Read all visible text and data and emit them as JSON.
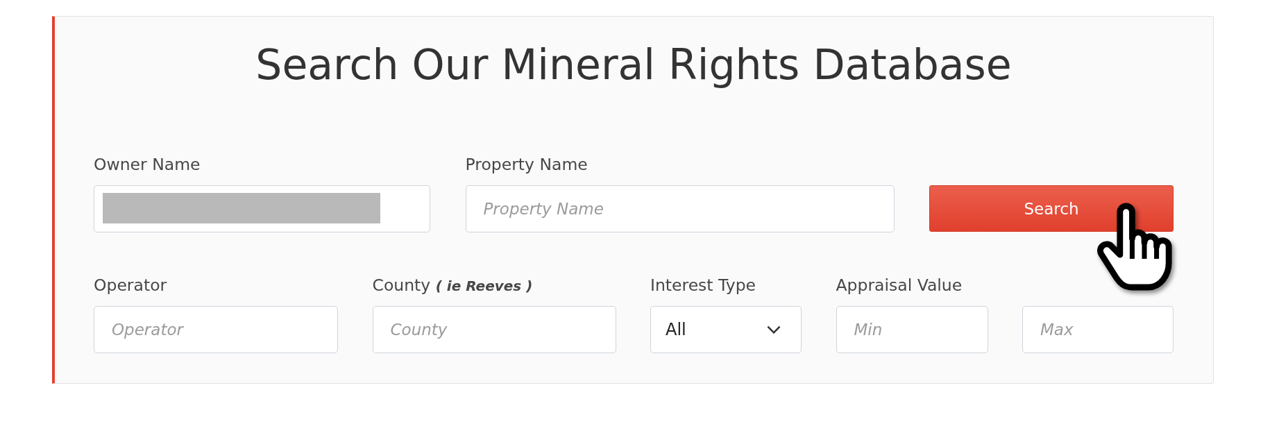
{
  "title": "Search Our Mineral Rights Database",
  "rows": [
    [
      {
        "kind": "text",
        "label": "Owner Name",
        "redacted": true
      },
      {
        "kind": "text",
        "label": "Property Name",
        "placeholder": "Property Name",
        "redacted": false
      },
      {
        "kind": "button",
        "label": "Search"
      }
    ],
    [
      {
        "kind": "text",
        "label": "Operator",
        "placeholder": "Operator",
        "redacted": false
      },
      {
        "kind": "text",
        "label": "County **( ie Reeves )**",
        "placeholder": "County",
        "redacted": false
      },
      {
        "kind": "select",
        "label": "Interest Type",
        "value": "All"
      },
      {
        "kind": "text",
        "label": "Appraisal Value",
        "placeholder": "Min",
        "redacted": false
      },
      {
        "kind": "text",
        "placeholder": "Max",
        "redacted": false
      }
    ]
  ]
}
